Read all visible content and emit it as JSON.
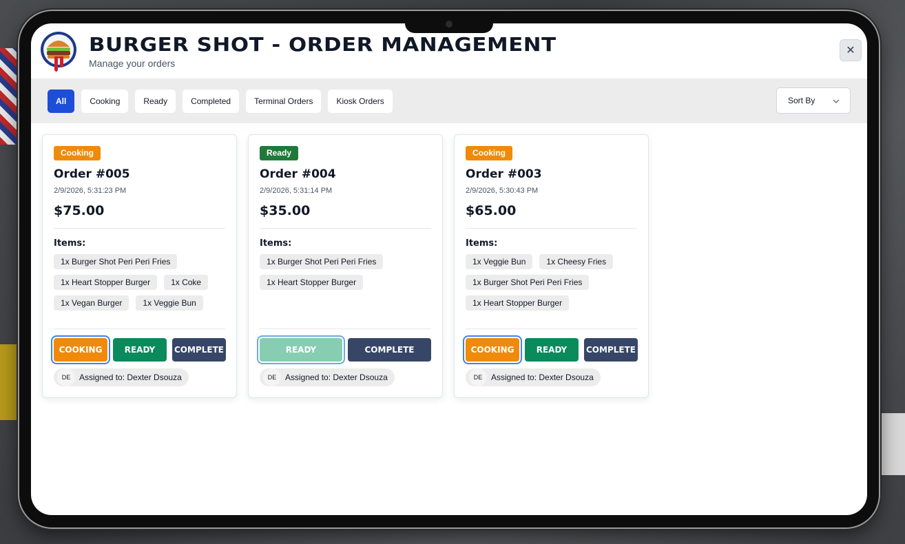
{
  "header": {
    "title": "BURGER SHOT - ORDER MANAGEMENT",
    "subtitle": "Manage your orders",
    "close_label": "✕"
  },
  "filters": [
    {
      "label": "All",
      "active": true
    },
    {
      "label": "Cooking",
      "active": false
    },
    {
      "label": "Ready",
      "active": false
    },
    {
      "label": "Completed",
      "active": false
    },
    {
      "label": "Terminal Orders",
      "active": false
    },
    {
      "label": "Kiosk Orders",
      "active": false
    }
  ],
  "sort": {
    "label": "Sort By"
  },
  "items_label": "Items:",
  "orders": [
    {
      "status": "Cooking",
      "status_color": "#f08a0a",
      "title": "Order #005",
      "timestamp": "2/9/2026, 5:31:23 PM",
      "total": "$75.00",
      "items": [
        "1x Burger Shot Peri Peri Fries",
        "1x Heart Stopper Burger",
        "1x Coke",
        "1x Vegan Burger",
        "1x Veggie Bun"
      ],
      "actions": {
        "cooking": "COOKING",
        "ready": "READY",
        "complete": "COMPLETE"
      },
      "assignee_initials": "DE",
      "assignee": "Assigned to: Dexter Dsouza"
    },
    {
      "status": "Ready",
      "status_color": "#1f7a3a",
      "title": "Order #004",
      "timestamp": "2/9/2026, 5:31:14 PM",
      "total": "$35.00",
      "items": [
        "1x Burger Shot Peri Peri Fries",
        "1x Heart Stopper Burger"
      ],
      "actions": {
        "ready": "READY",
        "complete": "COMPLETE"
      },
      "assignee_initials": "DE",
      "assignee": "Assigned to: Dexter Dsouza"
    },
    {
      "status": "Cooking",
      "status_color": "#f08a0a",
      "title": "Order #003",
      "timestamp": "2/9/2026, 5:30:43 PM",
      "total": "$65.00",
      "items": [
        "1x Veggie Bun",
        "1x Cheesy Fries",
        "1x Burger Shot Peri Peri Fries",
        "1x Heart Stopper Burger"
      ],
      "actions": {
        "cooking": "COOKING",
        "ready": "READY",
        "complete": "COMPLETE"
      },
      "assignee_initials": "DE",
      "assignee": "Assigned to: Dexter Dsouza"
    }
  ]
}
